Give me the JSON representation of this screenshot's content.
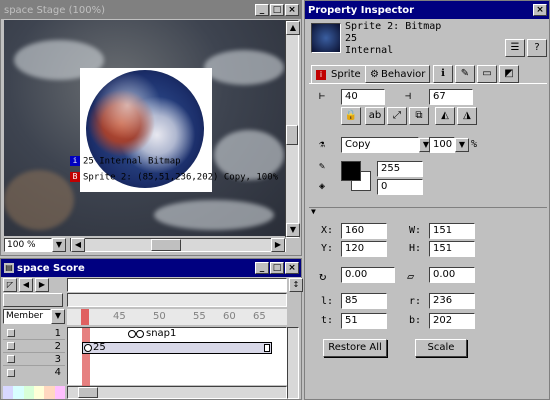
{
  "stage": {
    "title": "space Stage (100%)",
    "zoom": "100 %",
    "sprite_info_line1": "25  Internal  Bitmap",
    "sprite_info_line2": "Sprite 2: (85,51,236,202) Copy, 100%"
  },
  "score": {
    "title": "space Score",
    "member_label": "Member",
    "frame_numbers": [
      "45",
      "50",
      "55",
      "60",
      "65"
    ],
    "channel_numbers": [
      "1",
      "2",
      "3",
      "4"
    ],
    "marker_label": "snap1",
    "sprite_label": "25"
  },
  "inspector": {
    "title": "Property Inspector",
    "sprite_name": "Sprite 2: Bitmap",
    "member_number": "25",
    "cast_lib": "Internal",
    "tabs": [
      "Sprite",
      "Behavior"
    ],
    "start_frame": "40",
    "end_frame": "67",
    "ink": "Copy",
    "blend": "100",
    "blend_unit": "%",
    "fore_color_value": "255",
    "back_color_value": "0",
    "x_label": "X:",
    "x": "160",
    "y_label": "Y:",
    "y": "120",
    "w_label": "W:",
    "w": "151",
    "h_label": "H:",
    "h": "151",
    "rotation": "0.00",
    "skew": "0.00",
    "l_label": "l:",
    "l": "85",
    "r_label": "r:",
    "r": "236",
    "t_label": "t:",
    "t": "51",
    "b_label": "b:",
    "b": "202",
    "restore_all": "Restore All",
    "scale": "Scale",
    "accent": "#000080"
  }
}
